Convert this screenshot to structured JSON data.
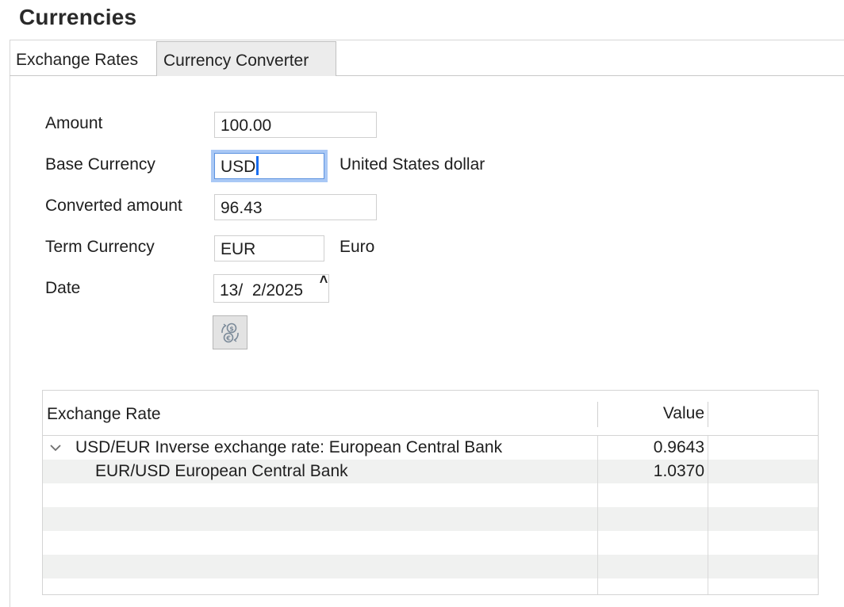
{
  "window": {
    "title": "Currencies"
  },
  "tabs": [
    {
      "label": "Exchange Rates",
      "active": false
    },
    {
      "label": "Currency Converter",
      "active": true
    }
  ],
  "form": {
    "amount": {
      "label": "Amount",
      "value": "100.00"
    },
    "base_currency": {
      "label": "Base Currency",
      "value": "USD",
      "name": "United States dollar"
    },
    "converted_amount": {
      "label": "Converted amount",
      "value": "96.43"
    },
    "term_currency": {
      "label": "Term Currency",
      "value": "EUR",
      "name": "Euro"
    },
    "date": {
      "label": "Date",
      "value": "13/  2/2025"
    },
    "convert_button": {
      "icon": "currency-exchange-icon"
    }
  },
  "table": {
    "columns": [
      "Exchange Rate",
      "Value"
    ],
    "rows": [
      {
        "label": "USD/EUR Inverse exchange rate: European Central Bank",
        "value": "0.9643",
        "expanded": true,
        "level": 0
      },
      {
        "label": "EUR/USD European Central Bank",
        "value": "1.0370",
        "level": 1
      }
    ]
  },
  "colors": {
    "focus_ring": "#a9c8f5",
    "caret": "#1a6ef0",
    "row_alt": "#f0f1f0",
    "active_tab": "#ececec"
  }
}
